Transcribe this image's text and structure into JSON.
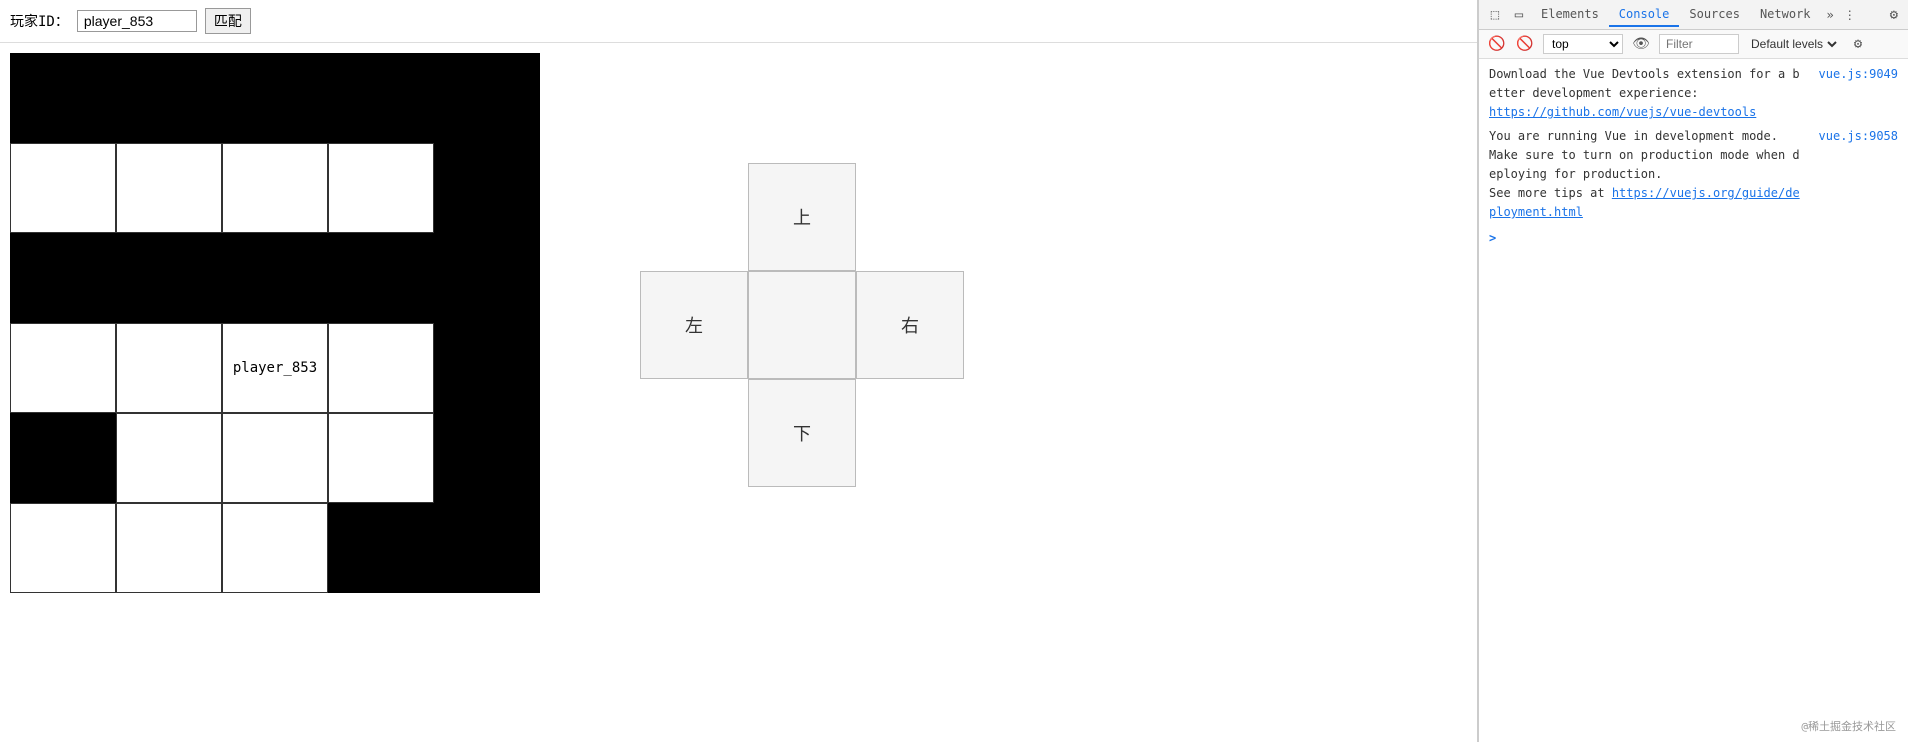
{
  "topbar": {
    "label": "玩家ID：",
    "player_id_value": "player_853",
    "match_button": "匹配"
  },
  "grid": {
    "rows": 6,
    "cols": 5,
    "cells": [
      "black",
      "black",
      "black",
      "black",
      "black",
      "white",
      "white",
      "white",
      "white",
      "black",
      "black",
      "black",
      "black",
      "black",
      "black",
      "white",
      "white",
      "player",
      "white",
      "black",
      "black",
      "white",
      "white",
      "white",
      "black",
      "white",
      "white",
      "white",
      "black",
      "black"
    ],
    "player_label": "player_853"
  },
  "dpad": {
    "up_label": "上",
    "left_label": "左",
    "right_label": "右",
    "down_label": "下"
  },
  "devtools": {
    "tabs": [
      "Elements",
      "Console",
      "Sources",
      "Network"
    ],
    "active_tab": "Console",
    "toolbar": {
      "context": "top",
      "filter_placeholder": "Filter",
      "default_levels": "Default levels"
    },
    "console_messages": [
      {
        "text": "Download the Vue Devtools extension for a better development experience:\nhttps://github.com/vuejs/vue-devtools",
        "source": "vue.js:9049",
        "link": "https://github.com/vuejs/vue-devtools"
      },
      {
        "text": "You are running Vue in development mode.\nMake sure to turn on production mode when deploying for production.\nSee more tips at https://vuejs.org/guide/deployment.html",
        "source": "vue.js:9058",
        "link": "https://vuejs.org/guide/deployment.html"
      }
    ]
  },
  "watermark": "@稀土掘金技术社区"
}
